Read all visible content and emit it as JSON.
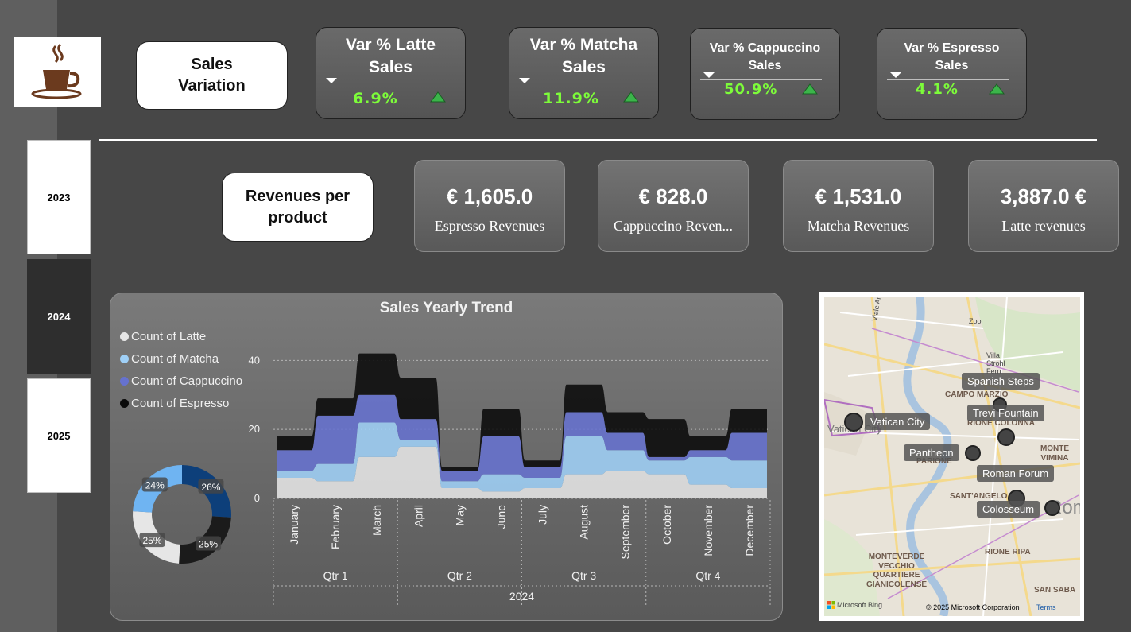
{
  "years": [
    "2023",
    "2024",
    "2025"
  ],
  "selected_year": "2024",
  "header": {
    "sales_variation_title": "Sales\nVariation"
  },
  "kpis": [
    {
      "title": "Var % Latte Sales",
      "value": "6.9%"
    },
    {
      "title": "Var % Matcha Sales",
      "value": "11.9%"
    },
    {
      "title": "Var % Cappuccino Sales",
      "value": "50.9%"
    },
    {
      "title": "Var % Espresso Sales",
      "value": "4.1%"
    }
  ],
  "revenues_title": "Revenues per product",
  "revenues": [
    {
      "amount": "€ 1,605.0",
      "label": "Espresso Revenues"
    },
    {
      "amount": "€ 828.0",
      "label": "Cappuccino Reven..."
    },
    {
      "amount": "€ 1,531.0",
      "label": "Matcha Revenues"
    },
    {
      "amount": "3,887.0 €",
      "label": "Latte revenues"
    }
  ],
  "colors": {
    "accent_green": "#7dfc3a",
    "latte": "#e6e6e6",
    "matcha": "#9fd0f7",
    "cappuccino": "#6672cf",
    "espresso": "#0a0a0a",
    "donut_navy": "#0d3f7a"
  },
  "chart_data": {
    "type": "area",
    "title": "Sales Yearly Trend",
    "categories": [
      "January",
      "February",
      "March",
      "April",
      "May",
      "June",
      "July",
      "August",
      "September",
      "October",
      "November",
      "December"
    ],
    "quarters": [
      "Qtr 1",
      "Qtr 2",
      "Qtr 3",
      "Qtr 4"
    ],
    "year_label": "2024",
    "yticks": [
      "0",
      "20",
      "40"
    ],
    "ylim": [
      0,
      44
    ],
    "series": [
      {
        "name": "Count of Latte",
        "values": [
          6,
          5,
          12,
          15,
          3,
          2,
          3,
          7,
          8,
          7,
          4,
          3
        ]
      },
      {
        "name": "Count of Matcha",
        "values": [
          2,
          5,
          10,
          2,
          2,
          5,
          3,
          11,
          6,
          4,
          8,
          8
        ]
      },
      {
        "name": "Count of Cappuccino",
        "values": [
          6,
          14,
          8,
          6,
          3,
          11,
          3,
          7,
          5,
          1,
          2,
          8
        ]
      },
      {
        "name": "Count of Espresso",
        "values": [
          4,
          5,
          12,
          12,
          1,
          8,
          2,
          8,
          6,
          11,
          4,
          7
        ]
      }
    ],
    "donut": {
      "slices": [
        {
          "label": "26%",
          "value": 26,
          "color": "#0d3f7a"
        },
        {
          "label": "25%",
          "value": 25,
          "color": "#1b1b1b"
        },
        {
          "label": "25%",
          "value": 25,
          "color": "#e6e6e6"
        },
        {
          "label": "24%",
          "value": 24,
          "color": "#6fb4f2"
        }
      ]
    }
  },
  "map": {
    "pins": [
      "Vatican City",
      "Spanish Steps",
      "Trevi Fountain",
      "Pantheon",
      "Roman Forum",
      "Colosseum"
    ],
    "areas": [
      "Viale Angelico",
      "Zoo",
      "Villa Strohl Fern",
      "CAMPO MARZIO",
      "RIONE COLONNA",
      "MONTE VIMINA",
      "PARIONE",
      "SANT'ANGELO",
      "MONTEVERDE VECCHIO QUARTIERE GIANICOLENSE",
      "RIONE RIPA",
      "SAN SABA"
    ],
    "bg_labels": [
      "Vatican City",
      "Rom"
    ],
    "logo": "Microsoft Bing",
    "copyright": "© 2025 Microsoft Corporation",
    "terms": "Terms"
  }
}
